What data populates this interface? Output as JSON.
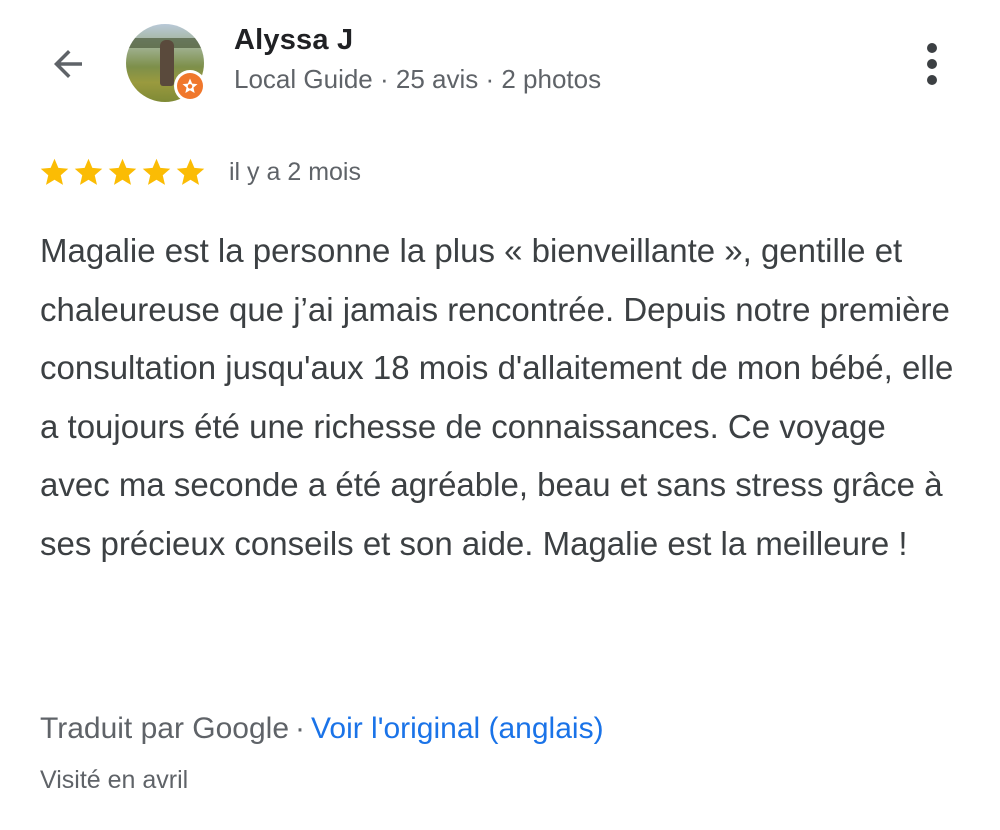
{
  "header": {
    "user_name": "Alyssa J",
    "user_meta": "Local Guide · 25 avis · 2 photos"
  },
  "icons": {
    "back": "arrow-back-icon",
    "more": "more-vert-icon",
    "badge": "local-guide-star-icon",
    "star": "star-icon"
  },
  "review": {
    "rating": 5,
    "rating_max": 5,
    "date": "il y a 2 mois",
    "text": "Magalie est la personne la plus « bienveillante », gentille et chaleureuse que j’ai jamais rencontrée. Depuis notre première consultation jusqu'aux 18 mois d'allaitement de mon bébé, elle a toujours été une richesse de connaissances. Ce voyage avec ma seconde a été agréable, beau et sans stress grâce à ses précieux conseils et son aide. Magalie est la meilleure !",
    "translated_by": "Traduit par Google",
    "separator": "·",
    "see_original": "Voir l'original (anglais)",
    "visited": "Visité en avril"
  },
  "colors": {
    "star": "#fbbc04",
    "link": "#1a73e8",
    "badge": "#f0772c",
    "text": "#3c4043",
    "secondary": "#5f6368"
  }
}
